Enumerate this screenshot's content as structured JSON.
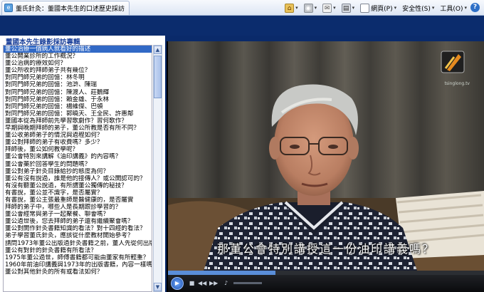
{
  "browser": {
    "tab_title": "董氏針灸：董國本先生的口述歷史採訪",
    "toolbar": {
      "page_label": "網頁(P)",
      "safety_label": "安全性(S)",
      "tools_label": "工具(O)"
    }
  },
  "left_panel": {
    "title": "董國本先生錄影採訪專輯",
    "selected_index": 0,
    "items": [
      "董公治療一個病人就看好的描述",
      "董公開業診所的工作概況？",
      "董公治病的療效如何？",
      "董公所收的拜師弟子共有幾位？",
      "對同門師兄弟的回憶：林冬明",
      "對同門師兄弟的回憶：池滸、陳瑞",
      "對同門師兄弟的回憶：陳渡人、莊鵝輝",
      "對同門師兄弟的回憶：賴金雄、于永林",
      "對同門師兄弟的回憶：楊維傑、巴頓",
      "對同門師兄弟的回憶：郭曉天、王全民、許惠鄰",
      "董國本從為拜師前先學習歌劇作？習何歌作？",
      "早期與晚期拜師的弟子，董公所教是否有所不同？",
      "董公收弟師弟子的情況與過程如何？",
      "董公對拜師的弟子有收費嗎？多少？",
      "拜師後，董公如何教學呢？",
      "董公會特別來講解《油印講義》的內容嗎？",
      "董公會藥於回答學生的問題嗎？",
      "董公對弟子針灸目錄給抄的態度為何？",
      "董公有沒有說過，誰是他的接傳人？或公開認可的？",
      "有沒有聽董公說過，有所謂董公獨傳的秘技？",
      "有書說，董公並不識字，是否屬實？",
      "有書說，董公主張最重師是醫健康的，是否屬實",
      "拜師的弟子中，哪些人是長期跟診學習的？",
      "董公會經常與弟子一起聚餐、聊會嗎？",
      "董公過世後，您去拜師的弟子還有繼續聚會嗎？",
      "董公對開作針灸書籍知識的看法？對十四經的看法？",
      "弟子學習董氏針灸，應該從什麼教材開始參考？",
      "請問1973年董公出版過針灸書籍之前，董人先從何出版？",
      "董公有對針的針灸書籍有所看法？",
      "1975年董公過世，師傅書籍都可能由董家有所輕重？",
      "1960年前油印講義與1973年的出版書籍，內容一樣嗎？",
      "董公對其他針灸的所有或看法如何？"
    ]
  },
  "video": {
    "subtitle": "那董公會特別講授這一份油印講義嗎？",
    "logo_text": "tsinglong.tv",
    "progress": 0.34,
    "accent_color": "#5a8ed9"
  }
}
